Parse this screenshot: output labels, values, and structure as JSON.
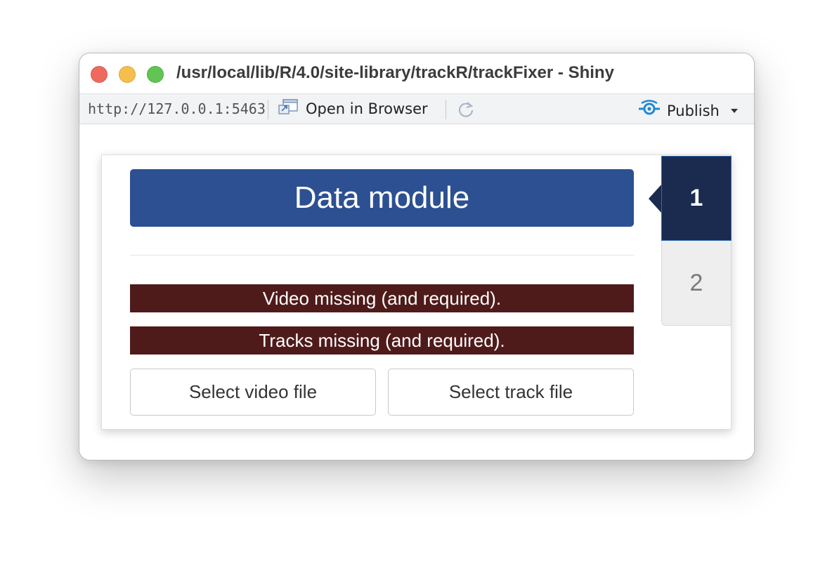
{
  "window": {
    "title": "/usr/local/lib/R/4.0/site-library/trackR/trackFixer - Shiny"
  },
  "toolbar": {
    "url": "http://127.0.0.1:5463",
    "open_in_browser_label": "Open in Browser",
    "publish_label": "Publish"
  },
  "module": {
    "title": "Data module",
    "alerts": [
      "Video missing (and required).",
      "Tracks missing (and required)."
    ],
    "buttons": {
      "select_video": "Select video file",
      "select_track": "Select track file"
    },
    "steps": [
      {
        "label": "1",
        "state": "active"
      },
      {
        "label": "2",
        "state": "inactive"
      }
    ]
  },
  "colors": {
    "module_title_bg": "#2c5091",
    "alert_bg": "#4f1b1a",
    "active_step_bg": "#1a2b4f",
    "inactive_step_bg": "#eeeeee",
    "publish_icon": "#1e88d6"
  },
  "icons": {
    "open_in_browser": "open-browser-icon",
    "refresh": "refresh-icon",
    "publish": "publish-icon",
    "dropdown": "caret-down-icon"
  }
}
